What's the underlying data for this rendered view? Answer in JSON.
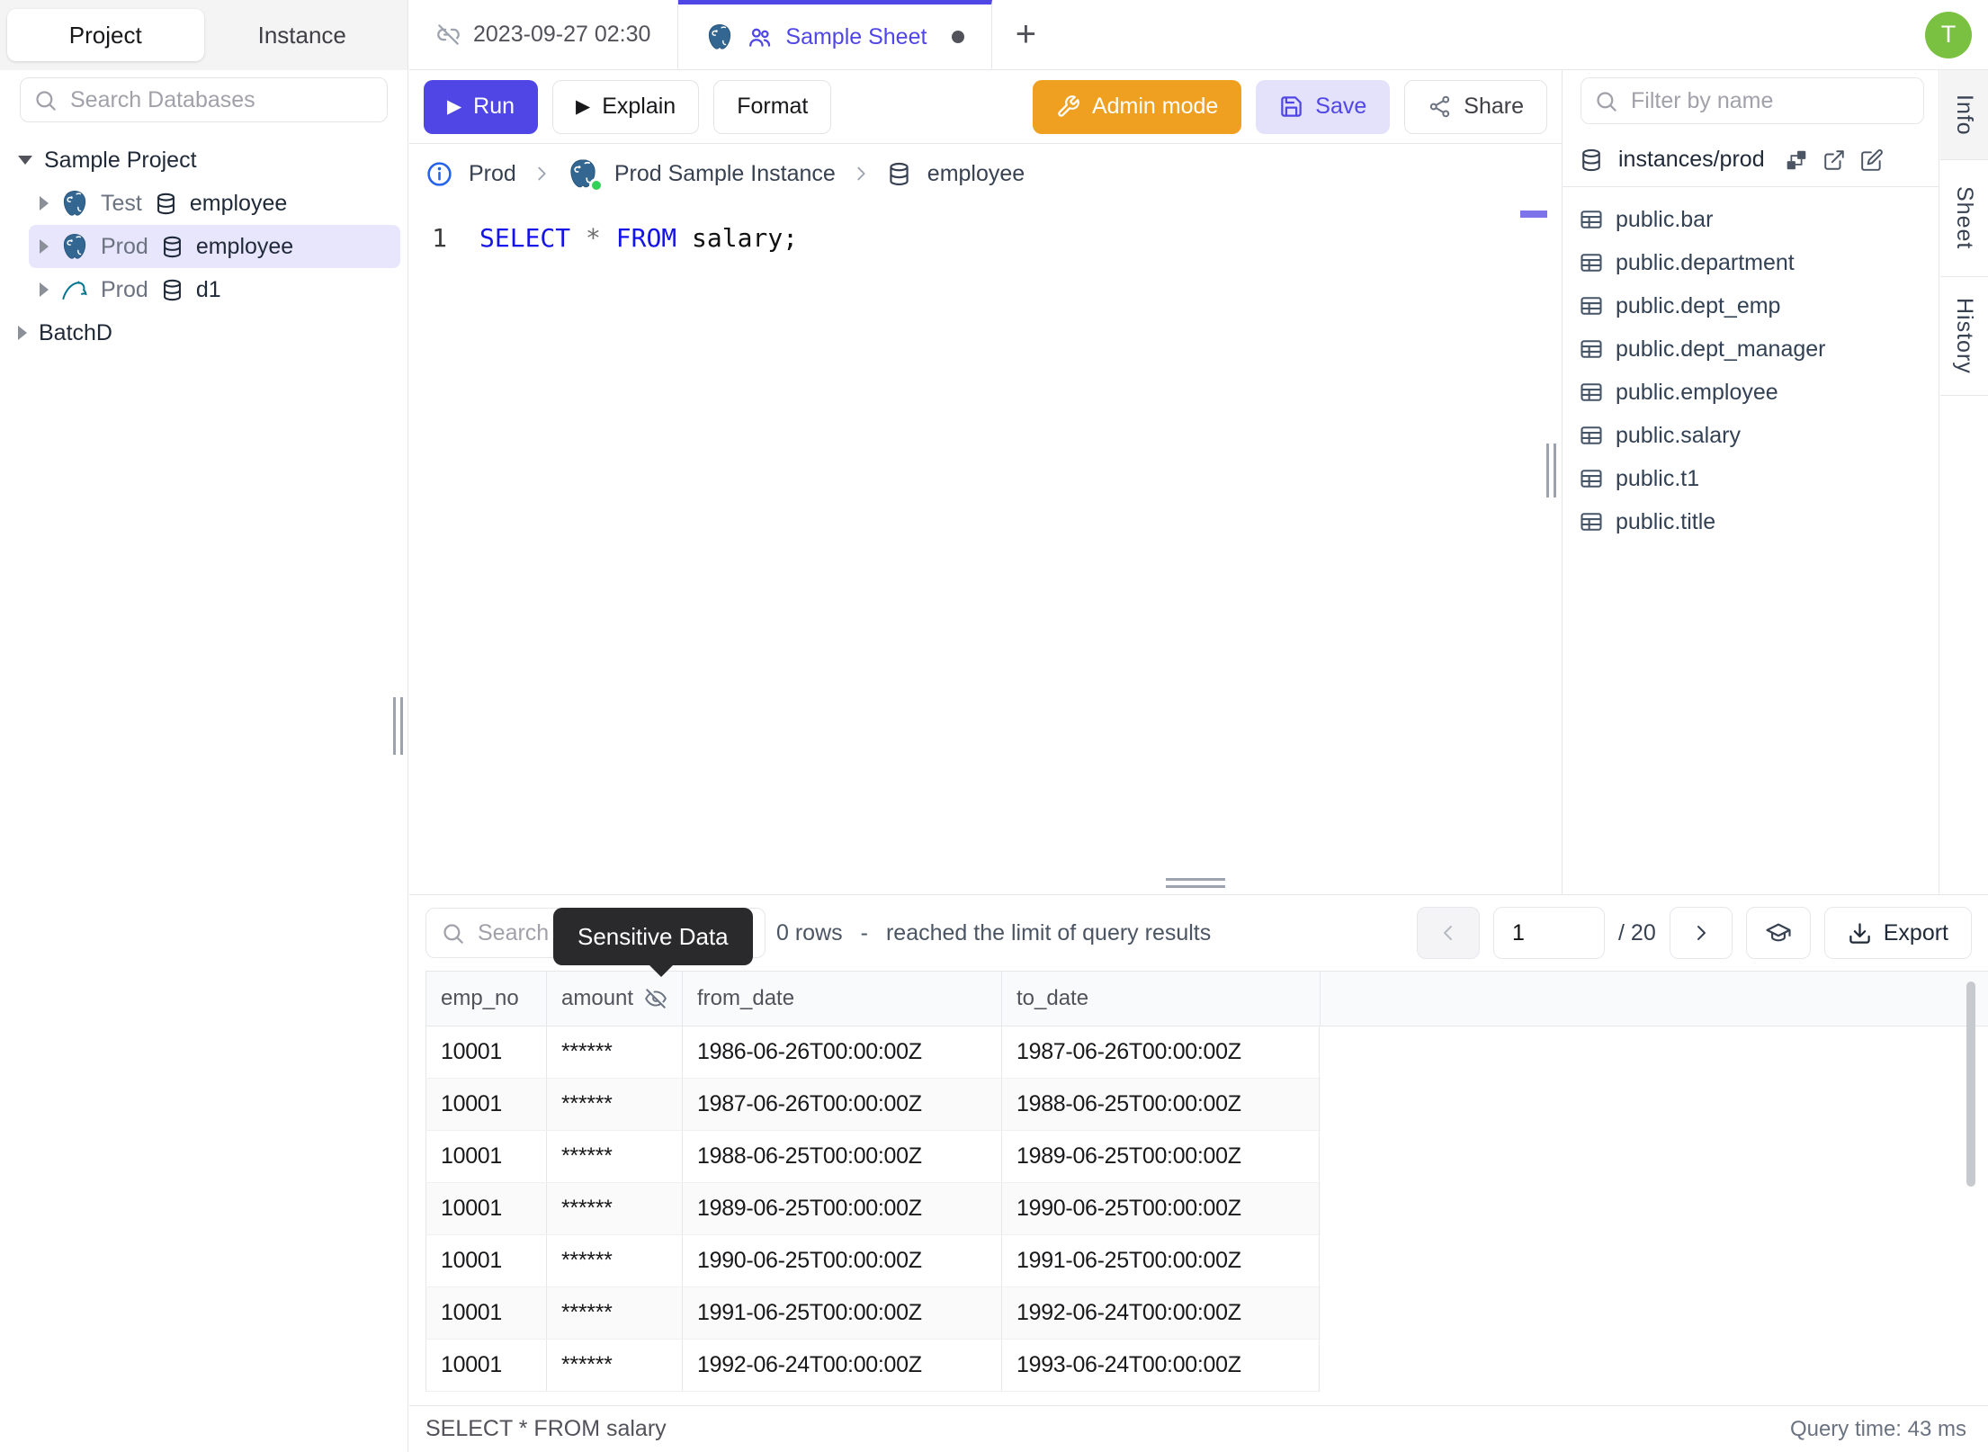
{
  "app": {
    "avatar_text": "T"
  },
  "sidebar": {
    "tabs": {
      "project": "Project",
      "instance": "Instance"
    },
    "search_placeholder": "Search Databases",
    "tree": {
      "project1": "Sample Project",
      "items": [
        {
          "env": "Test",
          "db": "employee",
          "engine": "postgres"
        },
        {
          "env": "Prod",
          "db": "employee",
          "engine": "postgres"
        },
        {
          "env": "Prod",
          "db": "d1",
          "engine": "mysql"
        }
      ],
      "project2": "BatchD"
    }
  },
  "tabbar": {
    "tab1": "2023-09-27 02:30",
    "tab2": "Sample Sheet",
    "new_tab": "+"
  },
  "toolbar": {
    "run": "Run",
    "explain": "Explain",
    "format": "Format",
    "admin": "Admin mode",
    "save": "Save",
    "share": "Share"
  },
  "breadcrumb": {
    "env": "Prod",
    "instance": "Prod Sample Instance",
    "database": "employee"
  },
  "editor": {
    "line_no": "1",
    "kw_select": "SELECT",
    "star": "*",
    "kw_from": "FROM",
    "ident": "salary;"
  },
  "schema_panel": {
    "filter_placeholder": "Filter by name",
    "header": "instances/prod",
    "tables": [
      "public.bar",
      "public.department",
      "public.dept_emp",
      "public.dept_manager",
      "public.employee",
      "public.salary",
      "public.t1",
      "public.title"
    ]
  },
  "rail": {
    "info": "Info",
    "sheet": "Sheet",
    "history": "History"
  },
  "results": {
    "search_placeholder": "Search",
    "tooltip": "Sensitive Data",
    "rows_count": "0 rows",
    "dash": "-",
    "limit_note": "reached the limit of query results",
    "page_value": "1",
    "page_total": "/ 20",
    "export_label": "Export",
    "columns": [
      "emp_no",
      "amount",
      "from_date",
      "to_date"
    ],
    "masked_value": "******",
    "rows": [
      [
        "10001",
        "******",
        "1986-06-26T00:00:00Z",
        "1987-06-26T00:00:00Z"
      ],
      [
        "10001",
        "******",
        "1987-06-26T00:00:00Z",
        "1988-06-25T00:00:00Z"
      ],
      [
        "10001",
        "******",
        "1988-06-25T00:00:00Z",
        "1989-06-25T00:00:00Z"
      ],
      [
        "10001",
        "******",
        "1989-06-25T00:00:00Z",
        "1990-06-25T00:00:00Z"
      ],
      [
        "10001",
        "******",
        "1990-06-25T00:00:00Z",
        "1991-06-25T00:00:00Z"
      ],
      [
        "10001",
        "******",
        "1991-06-25T00:00:00Z",
        "1992-06-24T00:00:00Z"
      ],
      [
        "10001",
        "******",
        "1992-06-24T00:00:00Z",
        "1993-06-24T00:00:00Z"
      ]
    ],
    "footer_sql": "SELECT * FROM salary",
    "footer_time": "Query time: 43 ms"
  },
  "colors": {
    "accent": "#4f46e5",
    "admin_orange": "#f0a020",
    "avatar_green": "#7ac142",
    "postgres_blue": "#336791",
    "mysql_teal": "#00758f",
    "tooltip_bg": "#2a2a2d",
    "keyword_blue": "#1414e8"
  }
}
